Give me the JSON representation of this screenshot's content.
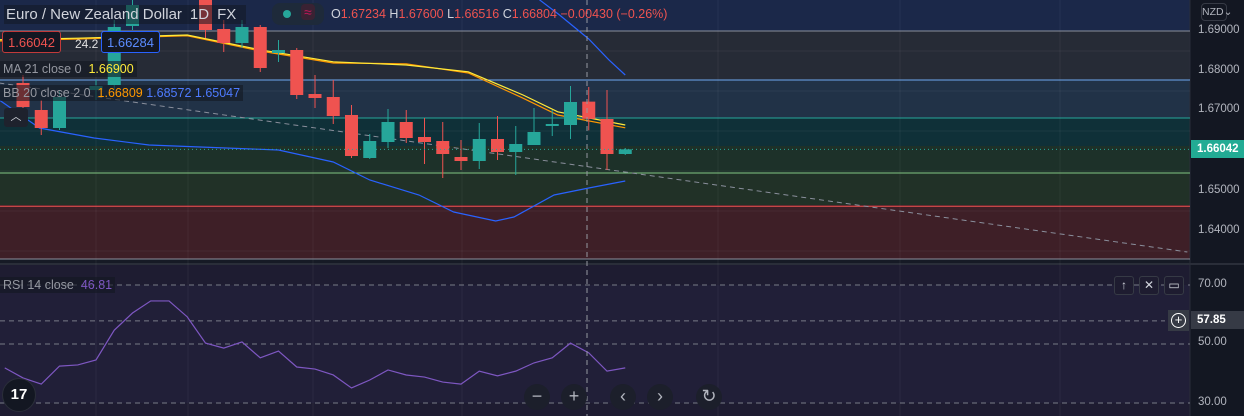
{
  "header": {
    "symbol": "Euro / New Zealand Dollar",
    "interval": "1D",
    "exchange": "FX",
    "ohlc": {
      "o_label": "O",
      "o": "1.67234",
      "h_label": "H",
      "h": "1.67600",
      "l_label": "L",
      "l": "1.66516",
      "c_label": "C",
      "c": "1.66804",
      "change": "−0.00430 (−0.26%)"
    }
  },
  "trade": {
    "sell": "1.66042",
    "spread": "24.2",
    "buy": "1.66284"
  },
  "legends": {
    "ma": {
      "name": "MA",
      "params": "21 close 0",
      "value": "1.66900"
    },
    "bb": {
      "name": "BB",
      "params": "20 close 2 0",
      "basis": "1.66809",
      "upper": "1.68572",
      "lower": "1.65047"
    },
    "rsi": {
      "name": "RSI",
      "params": "14 close",
      "value": "46.81"
    }
  },
  "collapse_icon": "chevron-up-icon",
  "price_axis": {
    "currency": "NZD",
    "labels": [
      "1.69000",
      "1.68000",
      "1.67000",
      "1.65000",
      "1.64000"
    ],
    "last_price": "1.66042"
  },
  "rsi_axis": {
    "labels": [
      "70.00",
      "50.00",
      "30.00"
    ],
    "crosshair_value": "57.85"
  },
  "nav": {
    "zoom_out": "−",
    "zoom_in": "+",
    "back": "‹",
    "forward": "›",
    "reset": "↻"
  },
  "pane_buttons": {
    "up": "↑",
    "close": "✕",
    "maximize": "▭"
  },
  "logo": "TV",
  "colors": {
    "up": "#26a69a",
    "down": "#ef5350",
    "ma": "#ffeb3b",
    "bb_basis": "#ff9800",
    "bb_band": "#2962ff",
    "rsi": "#7e57c2"
  },
  "chart_data": {
    "type": "candlestick",
    "price_range": [
      1.6325,
      1.6978
    ],
    "candles": [
      {
        "i": 0,
        "o": 1.677,
        "h": 1.679,
        "l": 1.6695,
        "c": 1.671
      },
      {
        "i": 1,
        "o": 1.67025,
        "h": 1.67275,
        "l": 1.664,
        "c": 1.66575
      },
      {
        "i": 2,
        "o": 1.66575,
        "h": 1.67525,
        "l": 1.66525,
        "c": 1.6735
      },
      {
        "i": 4,
        "o": 1.67525,
        "h": 1.67775,
        "l": 1.67275,
        "c": 1.67625
      },
      {
        "i": 5,
        "o": 1.6765,
        "h": 1.69275,
        "l": 1.67525,
        "c": 1.691
      },
      {
        "i": 6,
        "o": 1.69125,
        "h": 1.699,
        "l": 1.69025,
        "c": 1.6965
      },
      {
        "i": 10,
        "o": 1.69775,
        "h": 1.699,
        "l": 1.68825,
        "c": 1.69025
      },
      {
        "i": 11,
        "o": 1.6905,
        "h": 1.69275,
        "l": 1.68475,
        "c": 1.687
      },
      {
        "i": 12,
        "o": 1.687,
        "h": 1.69275,
        "l": 1.68575,
        "c": 1.691
      },
      {
        "i": 13,
        "o": 1.691,
        "h": 1.6915,
        "l": 1.67975,
        "c": 1.68075
      },
      {
        "i": 14,
        "o": 1.6845,
        "h": 1.68775,
        "l": 1.68225,
        "c": 1.68525
      },
      {
        "i": 15,
        "o": 1.68525,
        "h": 1.68575,
        "l": 1.673,
        "c": 1.674
      },
      {
        "i": 16,
        "o": 1.67425,
        "h": 1.679,
        "l": 1.67075,
        "c": 1.67325
      },
      {
        "i": 17,
        "o": 1.6735,
        "h": 1.67775,
        "l": 1.66675,
        "c": 1.66875
      },
      {
        "i": 18,
        "o": 1.669,
        "h": 1.6715,
        "l": 1.65825,
        "c": 1.65875
      },
      {
        "i": 19,
        "o": 1.65825,
        "h": 1.66425,
        "l": 1.658,
        "c": 1.6625
      },
      {
        "i": 20,
        "o": 1.66225,
        "h": 1.6705,
        "l": 1.66075,
        "c": 1.66725
      },
      {
        "i": 21,
        "o": 1.66725,
        "h": 1.67025,
        "l": 1.662,
        "c": 1.66325
      },
      {
        "i": 22,
        "o": 1.6635,
        "h": 1.66825,
        "l": 1.65675,
        "c": 1.66225
      },
      {
        "i": 23,
        "o": 1.6625,
        "h": 1.66725,
        "l": 1.65325,
        "c": 1.65925
      },
      {
        "i": 24,
        "o": 1.6585,
        "h": 1.66275,
        "l": 1.65525,
        "c": 1.6575
      },
      {
        "i": 25,
        "o": 1.6575,
        "h": 1.667,
        "l": 1.6555,
        "c": 1.663
      },
      {
        "i": 26,
        "o": 1.663,
        "h": 1.66875,
        "l": 1.65775,
        "c": 1.65975
      },
      {
        "i": 27,
        "o": 1.65975,
        "h": 1.66625,
        "l": 1.654,
        "c": 1.66175
      },
      {
        "i": 28,
        "o": 1.6615,
        "h": 1.67075,
        "l": 1.6615,
        "c": 1.66475
      },
      {
        "i": 29,
        "o": 1.66625,
        "h": 1.67025,
        "l": 1.66375,
        "c": 1.66675
      },
      {
        "i": 30,
        "o": 1.6665,
        "h": 1.67625,
        "l": 1.663,
        "c": 1.67225
      },
      {
        "i": 31,
        "o": 1.67234,
        "h": 1.676,
        "l": 1.66516,
        "c": 1.66804
      },
      {
        "i": 32,
        "o": 1.668,
        "h": 1.67525,
        "l": 1.65525,
        "c": 1.65925
      },
      {
        "i": 33,
        "o": 1.65925,
        "h": 1.66075,
        "l": 1.659,
        "c": 1.66042
      }
    ],
    "ma21": [
      [
        -1.3,
        1.6878
      ],
      [
        3,
        1.6882
      ],
      [
        9,
        1.689
      ],
      [
        13,
        1.6853
      ],
      [
        17,
        1.6823
      ],
      [
        21,
        1.6815
      ],
      [
        24.4,
        1.6798
      ],
      [
        27.4,
        1.674
      ],
      [
        29.3,
        1.6698
      ],
      [
        33,
        1.6665
      ]
    ],
    "bb_basis": [
      [
        -1.3,
        1.6875
      ],
      [
        3,
        1.688
      ],
      [
        9,
        1.6888
      ],
      [
        13,
        1.685
      ],
      [
        17,
        1.682
      ],
      [
        21,
        1.6818
      ],
      [
        24.4,
        1.6795
      ],
      [
        27.4,
        1.6732
      ],
      [
        29.3,
        1.669
      ],
      [
        33,
        1.6658
      ]
    ],
    "bb_upper": [
      [
        28.3,
        1.6978
      ],
      [
        29.4,
        1.694
      ],
      [
        31,
        1.688
      ],
      [
        32.1,
        1.6828
      ],
      [
        33,
        1.679
      ]
    ],
    "bb_lower": [
      [
        -1.3,
        1.67275
      ],
      [
        0.9,
        1.66575
      ],
      [
        3.9,
        1.66325
      ],
      [
        6.9,
        1.6615
      ],
      [
        14,
        1.66025
      ],
      [
        17,
        1.65725
      ],
      [
        19,
        1.65275
      ],
      [
        21.7,
        1.649
      ],
      [
        23.6,
        1.64475
      ],
      [
        25.9,
        1.6425
      ],
      [
        26.9,
        1.6435
      ],
      [
        29.1,
        1.649
      ],
      [
        31,
        1.65075
      ],
      [
        33,
        1.6525
      ]
    ],
    "trendline": [
      [
        -1.3,
        1.677
      ],
      [
        63.8,
        1.63475
      ]
    ],
    "levels": [
      1.69,
      1.67775,
      1.66825,
      1.6545,
      1.6462,
      1.633
    ],
    "rsi": {
      "start_index": -1,
      "values": [
        41.9,
        38.5,
        36.4,
        42.5,
        42.9,
        44.6,
        54.7,
        60.5,
        64.6,
        64.6,
        59.2,
        50.3,
        48.6,
        50.7,
        45.3,
        47.6,
        42.2,
        41.5,
        39.5,
        35.1,
        37.8,
        41.2,
        39.5,
        38.8,
        37.1,
        36.4,
        40.8,
        39.2,
        40.8,
        43.6,
        45.3,
        50.3,
        47.0,
        40.8,
        41.9
      ],
      "levels": [
        70,
        50,
        30
      ],
      "range": [
        30,
        70
      ]
    }
  }
}
